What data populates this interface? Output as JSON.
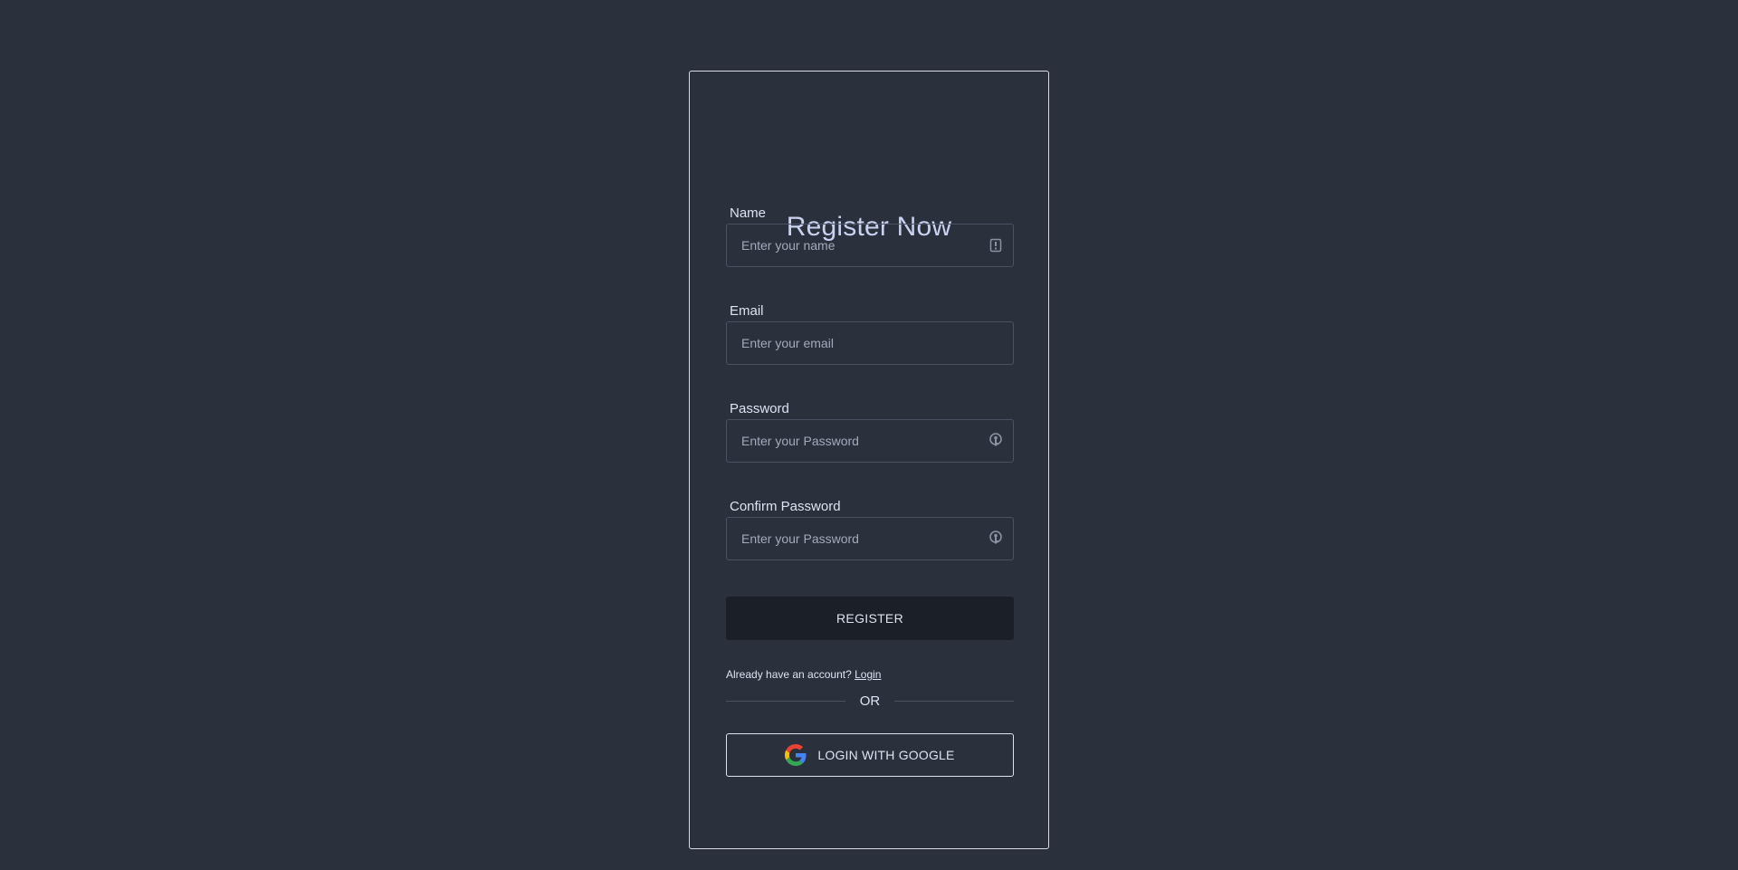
{
  "form": {
    "title": "Register Now",
    "name": {
      "label": "Name",
      "placeholder": "Enter your name",
      "value": "",
      "icon": "contact-card-icon"
    },
    "email": {
      "label": "Email",
      "placeholder": "Enter your email",
      "value": ""
    },
    "password": {
      "label": "Password",
      "placeholder": "Enter your Password",
      "value": "",
      "icon": "key-icon"
    },
    "confirm_password": {
      "label": "Confirm Password",
      "placeholder": "Enter your Password",
      "value": "",
      "icon": "key-icon"
    },
    "register_label": "REGISTER",
    "already_text": "Already have an account?",
    "login_link": "Login",
    "divider_text": "OR",
    "google_label": "LOGIN WITH GOOGLE"
  },
  "colors": {
    "background": "#2a303c",
    "card_border": "#d8dce6",
    "title": "#c9d3f0",
    "text": "#dde3f2",
    "input_border": "#4a5263",
    "register_bg": "#1b1f27"
  }
}
